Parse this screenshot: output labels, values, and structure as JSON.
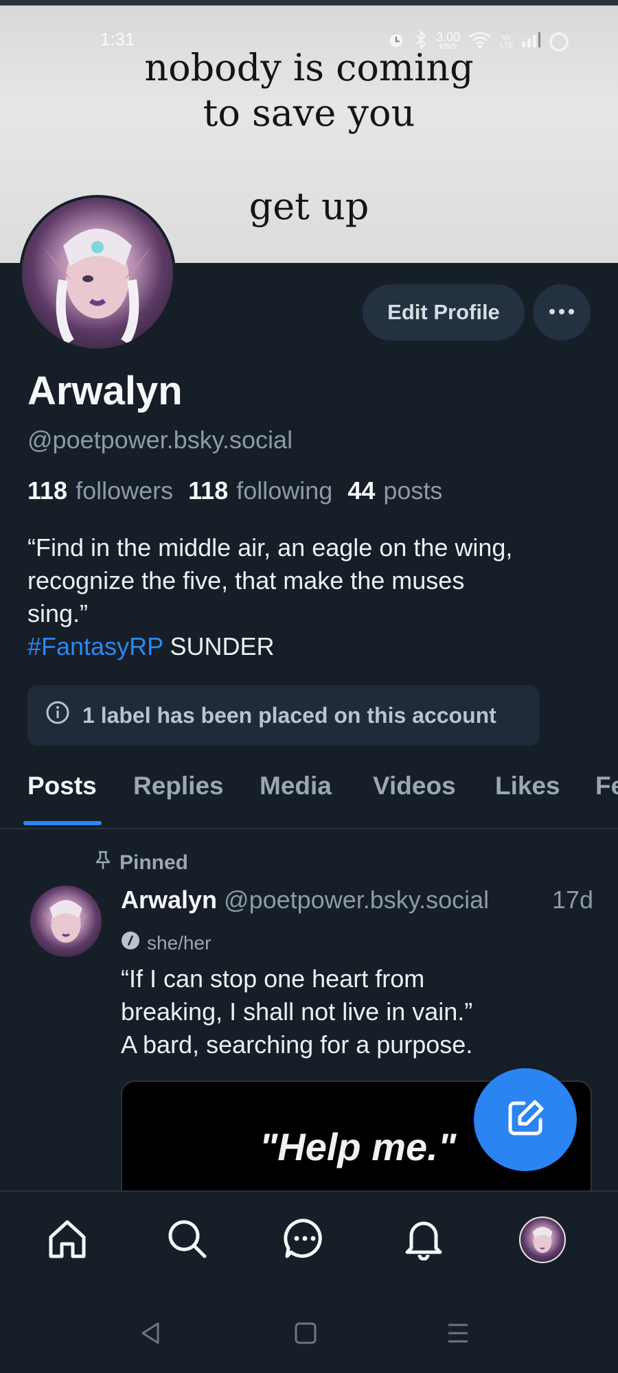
{
  "status_bar": {
    "time": "1:31",
    "net_speed": "3.00",
    "net_unit": "KB/S",
    "volte": "Vo LTE"
  },
  "banner": {
    "line1": "nobody is coming",
    "line2": "to save you",
    "line3": "get up"
  },
  "profile": {
    "edit_label": "Edit Profile",
    "more_label": "•••",
    "name": "Arwalyn",
    "handle": "@poetpower.bsky.social",
    "followers_count": "118",
    "followers_label": "followers",
    "following_count": "118",
    "following_label": "following",
    "posts_count": "44",
    "posts_label": "posts",
    "bio_line1": "“Find in the middle air, an eagle on the wing,",
    "bio_line2": "recognize the five, that make the muses",
    "bio_line3": "sing.”",
    "bio_tag": "#FantasyRP",
    "bio_tail": "SUNDER",
    "label_notice": "1 label has been placed on this account"
  },
  "tabs": [
    "Posts",
    "Replies",
    "Media",
    "Videos",
    "Likes",
    "Fe"
  ],
  "active_tab": "Posts",
  "post": {
    "pinned_label": "Pinned",
    "author": "Arwalyn",
    "handle": "@poetpower.bsky.social",
    "time": "17d",
    "pronouns": "she/her",
    "text": "“If I can stop one heart from\nbreaking, I shall not live in vain.”\n    A bard, searching for a purpose.",
    "embed_text": "\"Help me.\""
  },
  "colors": {
    "background": "#161e27",
    "accent": "#2a89f5",
    "muted": "#8d9aab"
  },
  "icons": [
    "alarm-icon",
    "bluetooth-icon",
    "wifi-icon",
    "signal-icon",
    "more-icon",
    "info-icon",
    "pin-icon",
    "compose-icon",
    "home-icon",
    "search-icon",
    "chat-icon",
    "bell-icon",
    "back-icon",
    "recents-icon",
    "menu-icon"
  ]
}
